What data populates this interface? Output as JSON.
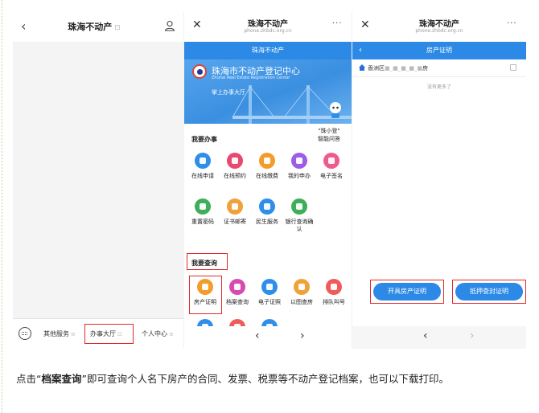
{
  "panel_a": {
    "title": "珠海不动产",
    "tabs": [
      "其他服务",
      "办事大厅",
      "个人中心"
    ]
  },
  "panel_b": {
    "window_title": "珠海不动产",
    "window_url": "phone.zhbdc.org.cn",
    "page_header": "珠海不动产",
    "org_name": "珠海市不动产登记中心",
    "org_name_en": "Zhuhai Real Estate Registration Center",
    "hall": "掌上办事大厅",
    "section_handle": "我要办事",
    "helper": [
      "\"珠小登\"",
      "智能问答"
    ],
    "services_row1": [
      "在线申请",
      "在线预约",
      "在线缴费",
      "我的申办",
      "电子签名"
    ],
    "services_row2": [
      "重置密码",
      "证书邮寄",
      "民生服务",
      "银行查询确认"
    ],
    "section_query": "我要查询",
    "query_row": [
      "房产证明",
      "档案查询",
      "电子证照",
      "以图查房",
      "排队叫号"
    ],
    "colors": {
      "accent": "#2c8ae6",
      "services_row1": [
        "#2f8ee8",
        "#e84a6e",
        "#f39c2b",
        "#9b5de5",
        "#ef5b8f"
      ],
      "services_row2": [
        "#3fae5a",
        "#f0a23a",
        "#2f8ee8",
        "#3fae5a"
      ],
      "query_row": [
        "#f39c2b",
        "#d64bb0",
        "#2f8ee8",
        "#f0a23a",
        "#ef5b5b"
      ],
      "partial_row": [
        "#2f8ee8",
        "#ef5b5b",
        "#2f8ee8"
      ]
    }
  },
  "panel_c": {
    "window_title": "珠海不动产",
    "window_url": "phone.zhbdc.org.cn",
    "page_header": "房产证明",
    "property_prefix": "香洲区",
    "property_suffix": "房",
    "no_more": "没有更多了",
    "buttons": [
      "开具房产证明",
      "抵押查封证明"
    ]
  },
  "caption": {
    "pre": "点击“",
    "bold": "档案查询",
    "post": "”即可查询个人名下房产的合同、发票、税票等不动产登记档案，也可以下载打印。"
  }
}
